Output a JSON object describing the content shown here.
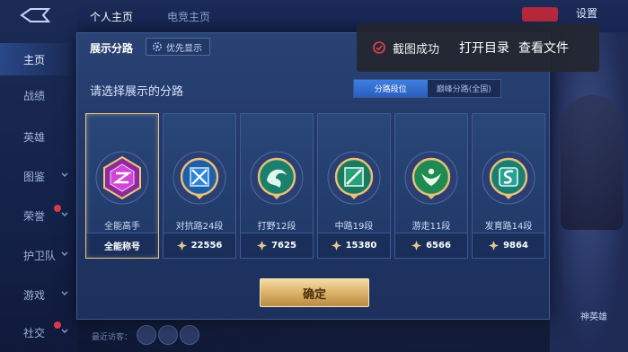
{
  "sidebar": {
    "items": [
      {
        "label": "主页",
        "active": true
      },
      {
        "label": "战绩"
      },
      {
        "label": "英雄"
      },
      {
        "label": "图鉴"
      },
      {
        "label": "荣誉"
      },
      {
        "label": "护卫队"
      },
      {
        "label": "游戏"
      },
      {
        "label": "社交"
      }
    ]
  },
  "topbar": {
    "tabs": [
      "个人主页",
      "电竞主页"
    ],
    "settings_label": "设置"
  },
  "right_panel": {
    "hero_tag": "神英雄"
  },
  "bottom": {
    "recent_label": "最近访客："
  },
  "dialog": {
    "title": "展示分路",
    "priority_label": "优先显示",
    "prompt": "请选择展示的分路",
    "toggle": [
      {
        "label": "分路段位",
        "selected": true
      },
      {
        "label": "巅峰分路(全国)",
        "selected": false
      }
    ],
    "cards": [
      {
        "label": "全能高手",
        "footer": "全能称号",
        "emblem_color": "#c23ac7",
        "selected": true
      },
      {
        "label": "对抗路24段",
        "footer": "22556",
        "emblem_color": "#2e7fc8"
      },
      {
        "label": "打野12段",
        "footer": "7625",
        "emblem_color": "#2aa68c"
      },
      {
        "label": "中路19段",
        "footer": "15380",
        "emblem_color": "#2a9f7a"
      },
      {
        "label": "游走11段",
        "footer": "6566",
        "emblem_color": "#3bab5f"
      },
      {
        "label": "发育路14段",
        "footer": "9864",
        "emblem_color": "#2e9b8c"
      }
    ],
    "confirm_label": "确定"
  },
  "toast": {
    "message": "截图成功",
    "open_dir": "打开目录",
    "view_file": "查看文件"
  },
  "colors": {
    "accent_gold": "#e9c78d",
    "toggle_blue": "#3e7fe0",
    "badge_red": "#d93a4a"
  }
}
